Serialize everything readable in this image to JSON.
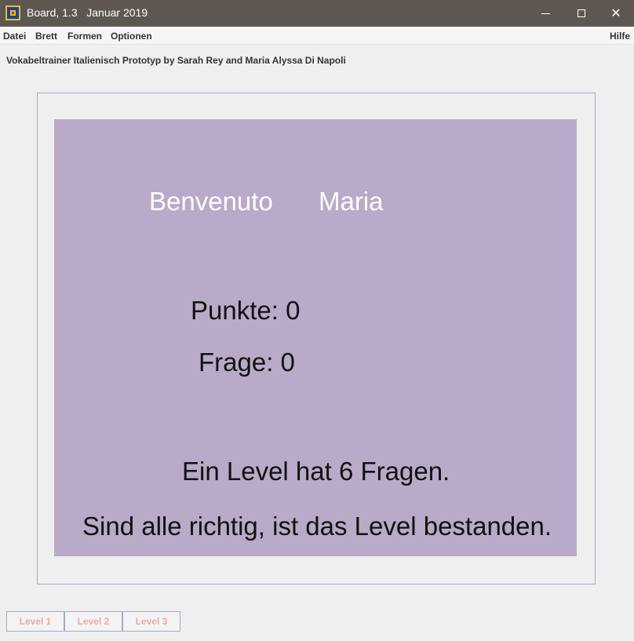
{
  "window": {
    "title": "Board, 1.3   Januar 2019",
    "app_icon": "board-app-icon",
    "controls": {
      "minimize_icon": "minimize-icon",
      "maximize_icon": "maximize-icon",
      "close_glyph": "✕"
    }
  },
  "menu": {
    "items": [
      "Datei",
      "Brett",
      "Formen",
      "Optionen"
    ],
    "help": "Hilfe"
  },
  "header": {
    "subtitle": "Vokabeltrainer Italienisch Prototyp by Sarah Rey and Maria Alyssa Di Napoli"
  },
  "board": {
    "background_color": "#b9aac9",
    "greeting": "Benvenuto",
    "user_name": "Maria",
    "points": "Punkte: 0",
    "question": "Frage: 0",
    "info_line_1": "Ein Level hat 6 Fragen.",
    "info_line_2": "Sind alle richtig, ist das Level bestanden."
  },
  "levels": {
    "buttons": [
      "Level 1",
      "Level 2",
      "Level 3"
    ],
    "label_color": "#f2a6a6"
  }
}
